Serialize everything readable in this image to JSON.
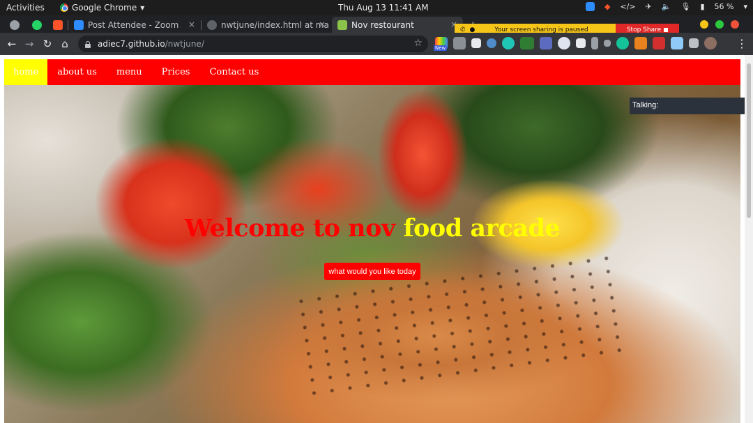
{
  "os_bar": {
    "activities": "Activities",
    "app_name": "Google Chrome",
    "app_arrow": "▾",
    "datetime": "Thu Aug 13  11:41 AM",
    "battery": "56 %"
  },
  "browser": {
    "tabs": [
      {
        "label": "",
        "icon": "globe-icon"
      },
      {
        "label": "",
        "icon": "whatsapp-icon"
      },
      {
        "label": "",
        "icon": "brave-icon"
      },
      {
        "label": "Post Attendee - Zoom",
        "icon": "zoom-icon"
      },
      {
        "label": "nwtjune/index.html at ma",
        "icon": "github-icon"
      },
      {
        "label": "Nov restourant",
        "icon": "site-favicon",
        "active": true
      }
    ],
    "close_glyph": "×",
    "new_tab_glyph": "+",
    "url_host": "adiec7.github.io",
    "url_path": "/nwtjune/",
    "new_badge": "New",
    "window_controls": {
      "minimize": "#f5c518",
      "maximize": "#2ac940",
      "close": "#f0523a"
    }
  },
  "share_notice": {
    "message": "Your screen sharing is paused",
    "stop_label": "Stop Share",
    "bar_color": "#f5c518",
    "stop_color": "#e02828"
  },
  "site": {
    "nav": [
      {
        "label": "home",
        "current": true
      },
      {
        "label": "about us"
      },
      {
        "label": "menu"
      },
      {
        "label": "Prices"
      },
      {
        "label": "Contact us"
      }
    ],
    "hero": {
      "title_red": "Welcome to nov",
      "title_yellow": "food arcade",
      "cta": "what would you like today"
    },
    "colors": {
      "nav": "#ff0000",
      "nav_current": "#ffff00",
      "title_red": "#ff0000",
      "title_yellow": "#ffff00"
    }
  },
  "zoom_overlay": {
    "talking_label": "Talking:"
  }
}
